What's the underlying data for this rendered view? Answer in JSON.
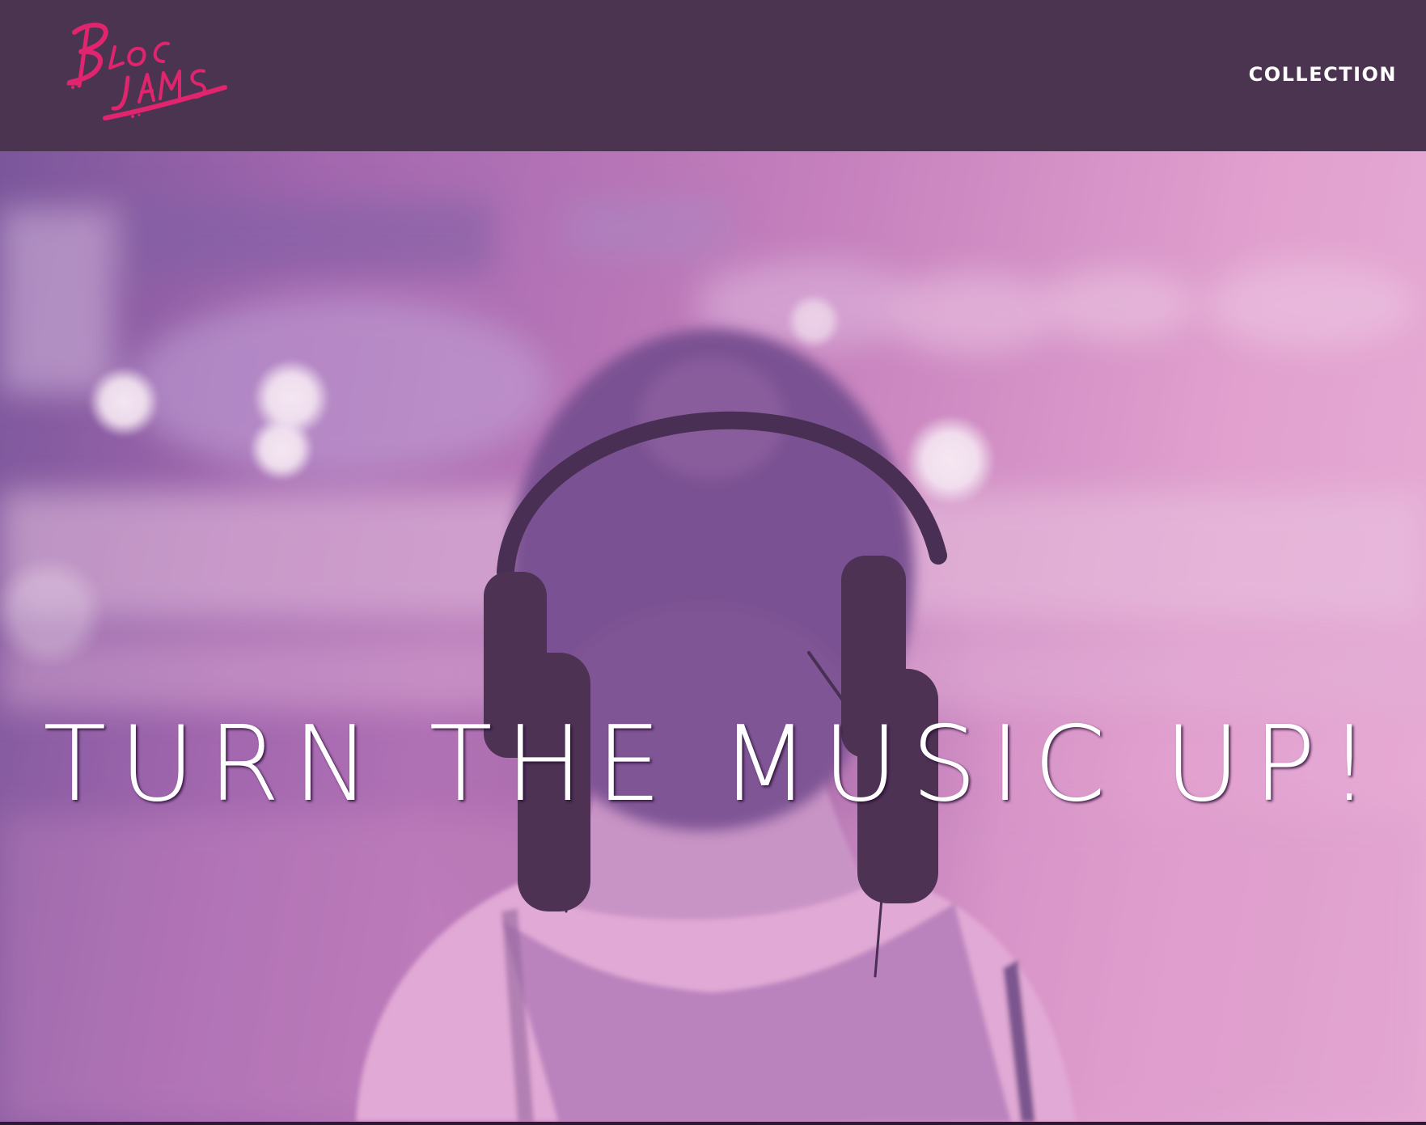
{
  "navbar": {
    "logo_text": "Bloc Jams",
    "collection_label": "COLLECTION"
  },
  "hero": {
    "title": "TURN THE MUSIC UP!"
  },
  "colors": {
    "navbar_bg": "#4b3450",
    "logo_accent": "#e0246e",
    "hero_tint_left": "#6a4f95",
    "hero_tint_right": "#efb8dd",
    "text": "#ffffff"
  }
}
